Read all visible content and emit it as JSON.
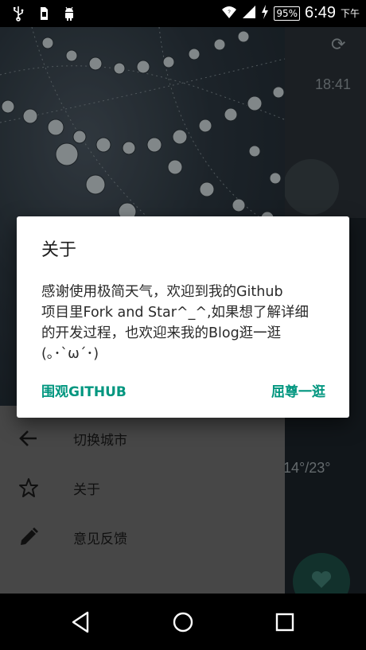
{
  "status_bar": {
    "battery": "95%",
    "time": "6:49",
    "ampm": "下午"
  },
  "background_app": {
    "time": "18:41",
    "temp": "14°/23°"
  },
  "drawer": {
    "items": [
      {
        "label": "切换城市",
        "icon": "arrow-back-icon"
      },
      {
        "label": "关于",
        "icon": "star-outline-icon"
      },
      {
        "label": "意见反馈",
        "icon": "pencil-icon"
      }
    ]
  },
  "dialog": {
    "title": "关于",
    "message": "感谢使用极简天气，欢迎到我的Github\n项目里Fork and Star^_^,如果想了解详细\n的开发过程，也欢迎来我的Blog逛一逛\n(｡･`ω´･)",
    "positive_label": "屈尊一逛",
    "neutral_label": "围观GITHUB"
  },
  "colors": {
    "accent": "#00967f",
    "fab": "#1d4c44"
  }
}
